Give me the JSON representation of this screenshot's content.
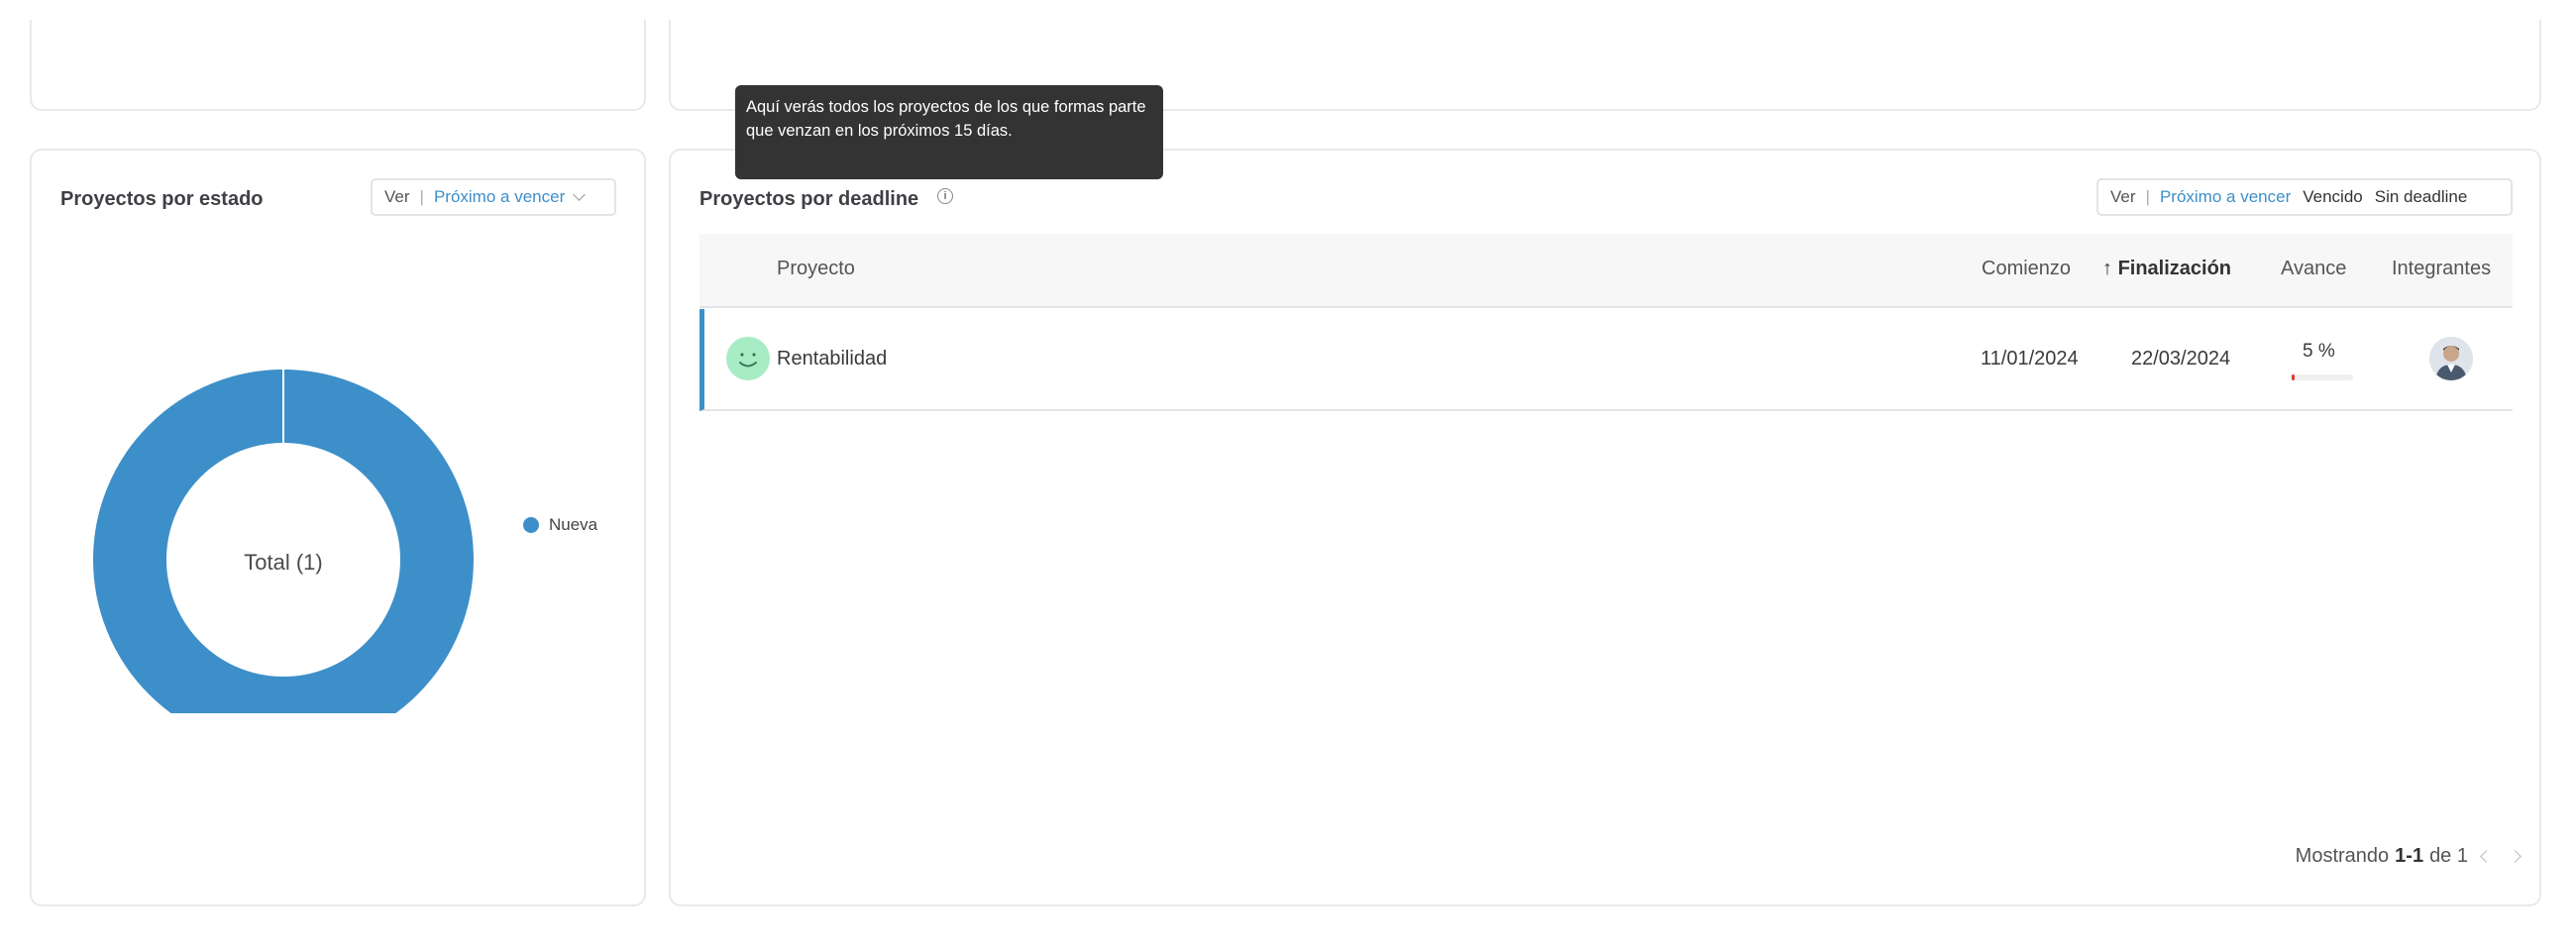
{
  "left_panel": {
    "title": "Proyectos por estado",
    "filter": {
      "prefix": "Ver",
      "selected": "Próximo a vencer"
    },
    "donut": {
      "center_label": "Total (1)",
      "color": "#3d8fc9"
    },
    "legend": [
      {
        "label": "Nueva",
        "color": "#3d8fc9"
      }
    ]
  },
  "right_panel": {
    "title": "Proyectos por deadline",
    "tooltip": "Aquí verás todos los proyectos de los que formas parte que venzan en los próximos 15 días.",
    "filter": {
      "prefix": "Ver",
      "selected": "Próximo a vencer",
      "options": [
        "Vencido",
        "Sin deadline"
      ]
    },
    "columns": {
      "project": "Proyecto",
      "start": "Comienzo",
      "end_arrow": "↑",
      "end": "Finalización",
      "progress": "Avance",
      "members": "Integrantes"
    },
    "rows": [
      {
        "status_icon": "smile-icon",
        "name": "Rentabilidad",
        "start": "11/01/2024",
        "end": "22/03/2024",
        "progress_label": "5 %",
        "progress": 5
      }
    ],
    "pagination": {
      "prefix": "Mostrando",
      "range": "1-1",
      "of": "de 1"
    }
  },
  "colors": {
    "accent": "#3d8fc9",
    "progress_bar": "#e53935",
    "status_green": "#a8ecc5"
  }
}
